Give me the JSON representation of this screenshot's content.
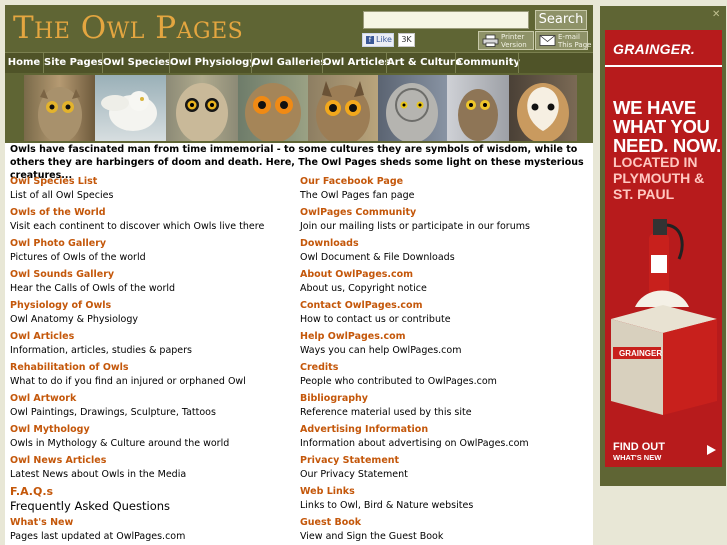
{
  "header": {
    "logo_text": "The Owl Pages",
    "search_placeholder": "",
    "search_button": "Search",
    "fb_like": "Like",
    "fb_count": "3K",
    "printer_label": "Printer\nVersion",
    "email_label": "E-mail\nThis Page"
  },
  "nav": {
    "items": [
      {
        "label": "Home"
      },
      {
        "label": "Site Pages"
      },
      {
        "label": "Owl Species"
      },
      {
        "label": "Owl Physiology"
      },
      {
        "label": "Owl Galleries"
      },
      {
        "label": "Owl Articles"
      },
      {
        "label": "Art & Culture"
      },
      {
        "label": "Community"
      }
    ]
  },
  "banner": {
    "owls": [
      "screech-owl",
      "snowy-owl",
      "short-eared-owl",
      "eagle-owl",
      "great-horned-owl",
      "great-grey-owl",
      "pygmy-owl",
      "barn-owl"
    ]
  },
  "intro": "Owls have fascinated man from time immemorial - to some cultures they are symbols of wisdom, while to others they are harbingers of doom and death. Here, The Owl Pages sheds some light on these mysterious creatures...",
  "left_links": [
    {
      "title": "Owl Species List",
      "desc": "List of all Owl Species"
    },
    {
      "title": "Owls of the World",
      "desc": "Visit each continent to discover which Owls live there"
    },
    {
      "title": "Owl Photo Gallery",
      "desc": "Pictures of Owls of the world"
    },
    {
      "title": "Owl Sounds Gallery",
      "desc": "Hear the Calls of Owls of the world"
    },
    {
      "title": "Physiology of Owls",
      "desc": "Owl Anatomy & Physiology"
    },
    {
      "title": "Owl Articles",
      "desc": "Information, articles, studies & papers"
    },
    {
      "title": "Rehabilitation of Owls",
      "desc": "What to do if you find an injured or orphaned Owl"
    },
    {
      "title": "Owl Artwork",
      "desc": "Owl Paintings, Drawings, Sculpture, Tattoos"
    },
    {
      "title": "Owl Mythology",
      "desc": "Owls in Mythology & Culture around the world"
    },
    {
      "title": "Owl News Articles",
      "desc": "Latest News about Owls in the Media"
    },
    {
      "title": "F.A.Q.s",
      "desc": "Frequently Asked Questions"
    },
    {
      "title": "What's New",
      "desc": "Pages last updated at OwlPages.com"
    }
  ],
  "right_links": [
    {
      "title": "Our Facebook Page",
      "desc": "The Owl Pages fan page"
    },
    {
      "title": "OwlPages Community",
      "desc": "Join our mailing lists or participate in our forums"
    },
    {
      "title": "Downloads",
      "desc": "Owl Document & File Downloads"
    },
    {
      "title": "About OwlPages.com",
      "desc": "About us, Copyright notice"
    },
    {
      "title": "Contact OwlPages.com",
      "desc": "How to contact us or contribute"
    },
    {
      "title": "Help OwlPages.com",
      "desc": "Ways you can help OwlPages.com"
    },
    {
      "title": "Credits",
      "desc": "People who contributed to OwlPages.com"
    },
    {
      "title": "Bibliography",
      "desc": "Reference material used by this site"
    },
    {
      "title": "Advertising Information",
      "desc": "Information about advertising on OwlPages.com"
    },
    {
      "title": "Privacy Statement",
      "desc": "Our Privacy Statement"
    },
    {
      "title": "Web Links",
      "desc": "Links to Owl, Bird & Nature websites"
    },
    {
      "title": "Guest Book",
      "desc": "View and Sign the Guest Book"
    }
  ],
  "ad": {
    "close": "✕",
    "logo": "GRAINGER.",
    "headline": "WE HAVE WHAT YOU NEED. NOW.",
    "subline": "LOCATED IN PLYMOUTH & ST. PAUL",
    "box_logo": "GRAINGER",
    "cta": "FIND OUT",
    "cta_sub": "WHAT'S NEW"
  },
  "colors": {
    "header_bg": "#5f6534",
    "nav_bg": "#4f5328",
    "logo": "#e4a640",
    "link_title": "#c4570a",
    "ad_red": "#b71b1c"
  }
}
